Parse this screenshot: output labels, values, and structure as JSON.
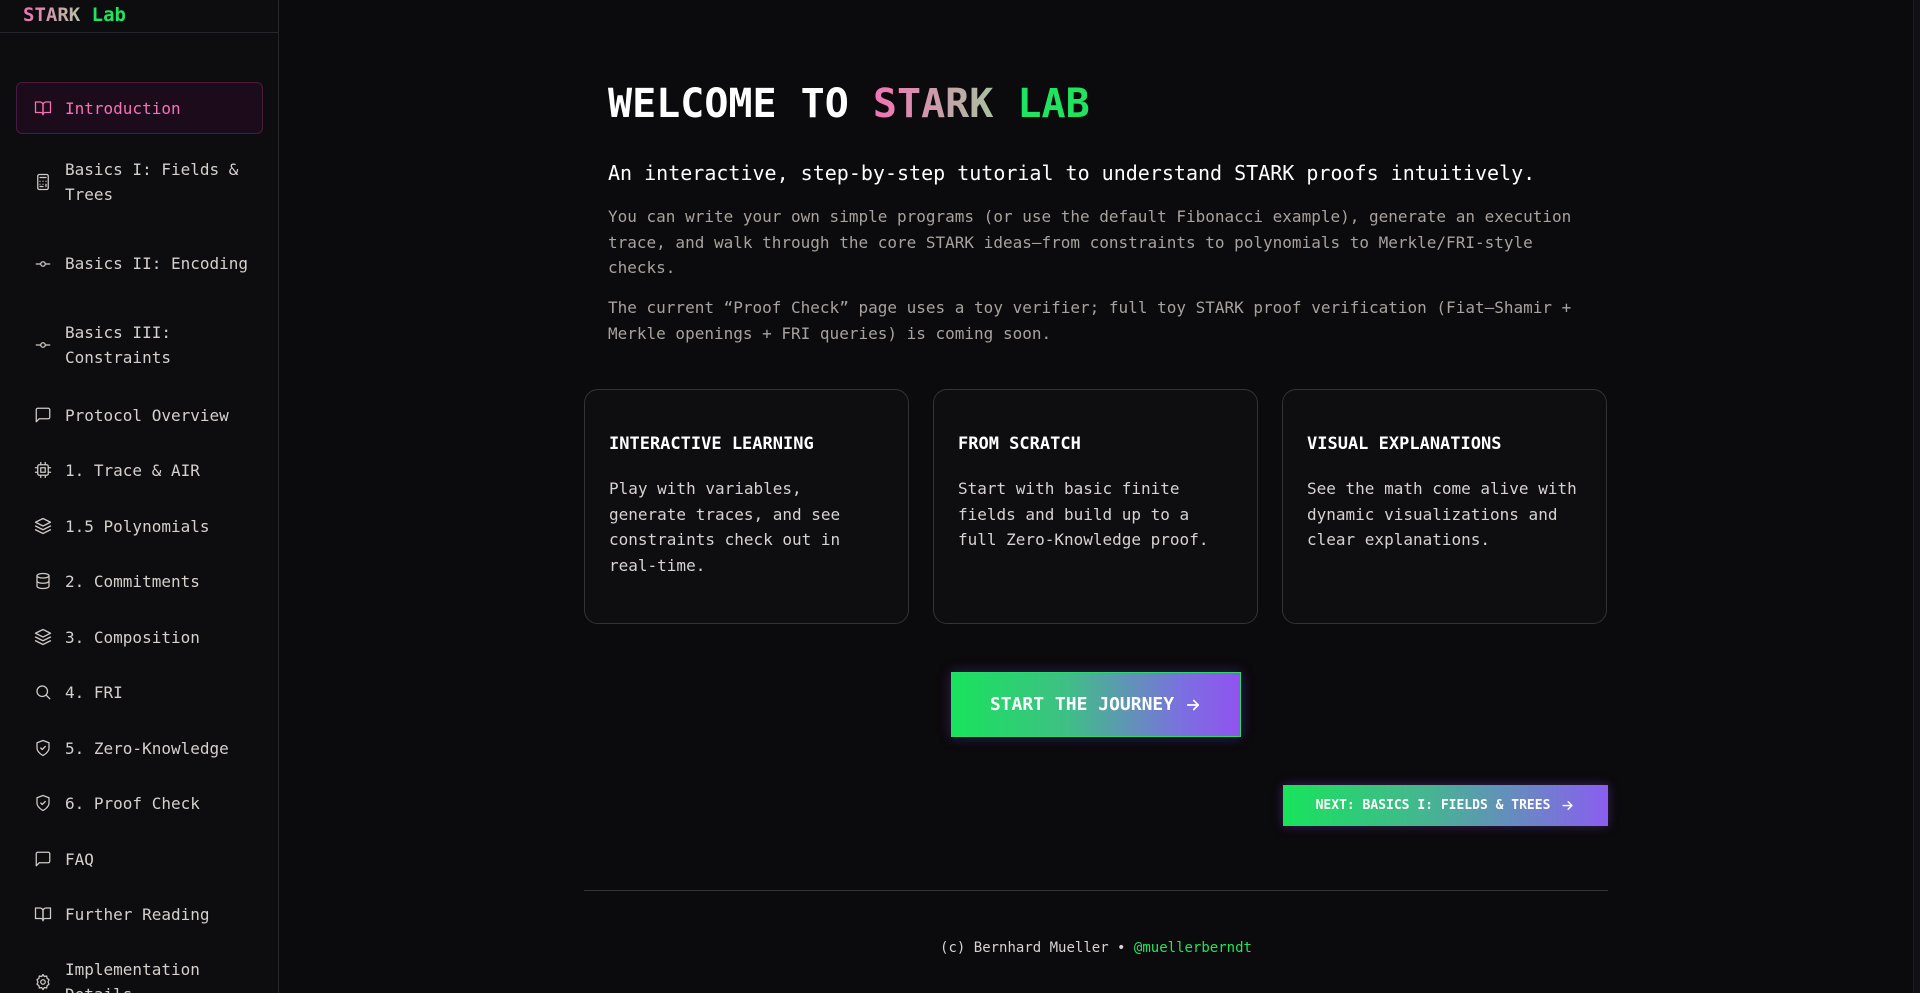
{
  "brand": {
    "part1": "STARK",
    "part2": "Lab"
  },
  "sidebar": {
    "items": [
      {
        "label": "Introduction",
        "icon": "book-open-icon",
        "active": true
      },
      {
        "label": "Basics I: Fields & Trees",
        "icon": "calculator-icon"
      },
      {
        "label": "Basics II: Encoding",
        "icon": "git-commit-icon"
      },
      {
        "label": "Basics III: Constraints",
        "icon": "git-commit-icon"
      },
      {
        "label": "Protocol Overview",
        "icon": "message-square-icon"
      },
      {
        "label": "1. Trace & AIR",
        "icon": "cpu-icon"
      },
      {
        "label": "1.5 Polynomials",
        "icon": "layers-icon"
      },
      {
        "label": "2. Commitments",
        "icon": "database-icon"
      },
      {
        "label": "3. Composition",
        "icon": "layers-icon"
      },
      {
        "label": "4. FRI",
        "icon": "search-icon"
      },
      {
        "label": "5. Zero-Knowledge",
        "icon": "shield-check-icon"
      },
      {
        "label": "6. Proof Check",
        "icon": "shield-check-icon"
      },
      {
        "label": "FAQ",
        "icon": "message-square-icon"
      },
      {
        "label": "Further Reading",
        "icon": "book-open-icon"
      },
      {
        "label": "Implementation Details",
        "icon": "settings-icon"
      }
    ]
  },
  "main": {
    "title": {
      "prefix": "WELCOME TO ",
      "stark": "STARK",
      "lab": "LAB"
    },
    "lead": "An interactive, step-by-step tutorial to understand STARK proofs intuitively.",
    "paragraph1": "You can write your own simple programs (or use the default Fibonacci example), generate an execution trace, and walk through the core STARK ideas—from constraints to polynomials to Merkle/FRI-style checks.",
    "paragraph2": "The current “Proof Check” page uses a toy verifier; full toy STARK proof verification (Fiat–Shamir + Merkle openings + FRI queries) is coming soon.",
    "cards": [
      {
        "title": "INTERACTIVE LEARNING",
        "body": "Play with variables, generate traces, and see constraints check out in real-time."
      },
      {
        "title": "FROM SCRATCH",
        "body": "Start with basic finite fields and build up to a full Zero-Knowledge proof."
      },
      {
        "title": "VISUAL EXPLANATIONS",
        "body": "See the math come alive with dynamic visualizations and clear explanations."
      }
    ],
    "cta_label": "START THE JOURNEY",
    "next_label": "NEXT: BASICS I: FIELDS & TREES",
    "footer": {
      "copyright": "(c) Bernhard Mueller • ",
      "handle": "@muellerberndt"
    }
  },
  "colors": {
    "background": "#0b0a0c",
    "accent_pink": "#f472b6",
    "accent_green": "#22e35f",
    "accent_purple": "#9153f0"
  }
}
